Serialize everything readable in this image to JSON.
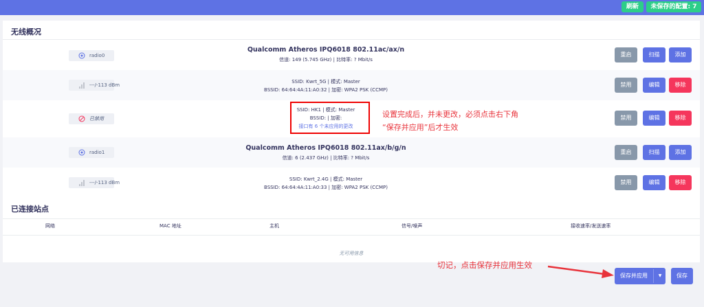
{
  "topbar": {
    "refresh": "刷新",
    "unsaved": "未保存的配置: 7"
  },
  "wireless": {
    "title": "无线概况",
    "rows": [
      {
        "badge": "radio0",
        "line1": "Qualcomm Atheros IPQ6018 802.11ac/ax/n",
        "line2": "信道: 149 (5.745 GHz) | 比特率: ? Mbit/s",
        "buttons": [
          "重启",
          "扫描",
          "添加"
        ]
      },
      {
        "badge": "---/-113 dBm",
        "line1": "SSID: Kwrt_5G | 模式: Master",
        "line2": "BSSID: 64:64:4A:11:A0:32 | 加密: WPA2 PSK (CCMP)",
        "buttons": [
          "禁用",
          "编辑",
          "移除"
        ]
      },
      {
        "badge": "已禁用",
        "line1": "SSID: HK1 | 模式: Master",
        "line2": "BSSID: | 加密:",
        "line3": "接口有 6 个未应用的更改",
        "buttons": [
          "禁用",
          "编辑",
          "移除"
        ]
      },
      {
        "badge": "radio1",
        "line1": "Qualcomm Atheros IPQ6018 802.11ax/b/g/n",
        "line2": "信道: 6 (2.437 GHz) | 比特率: ? Mbit/s",
        "buttons": [
          "重启",
          "扫描",
          "添加"
        ]
      },
      {
        "badge": "---/-113 dBm",
        "line1": "SSID: Kwrt_2.4G | 模式: Master",
        "line2": "BSSID: 64:64:4A:11:A0:33 | 加密: WPA2 PSK (CCMP)",
        "buttons": [
          "禁用",
          "编辑",
          "移除"
        ]
      }
    ]
  },
  "annotation1": {
    "line1": "设置完成后，并未更改，必须点击右下角",
    "line2": "“保存并应用”后才生效"
  },
  "stations": {
    "title": "已连接站点",
    "columns": [
      "网络",
      "MAC 地址",
      "主机",
      "信号/噪声",
      "接收速率/发送速率"
    ],
    "empty": "无可用信息"
  },
  "annotation2": "切记，点击保存并应用生效",
  "footer": {
    "save_apply": "保存并应用",
    "caret": "▼",
    "save": "保存"
  },
  "colors": {
    "accent": "#5e72e4",
    "success": "#2dce89",
    "danger": "#f5365c",
    "neutral": "#8898aa",
    "annotation": "#e8333b"
  }
}
